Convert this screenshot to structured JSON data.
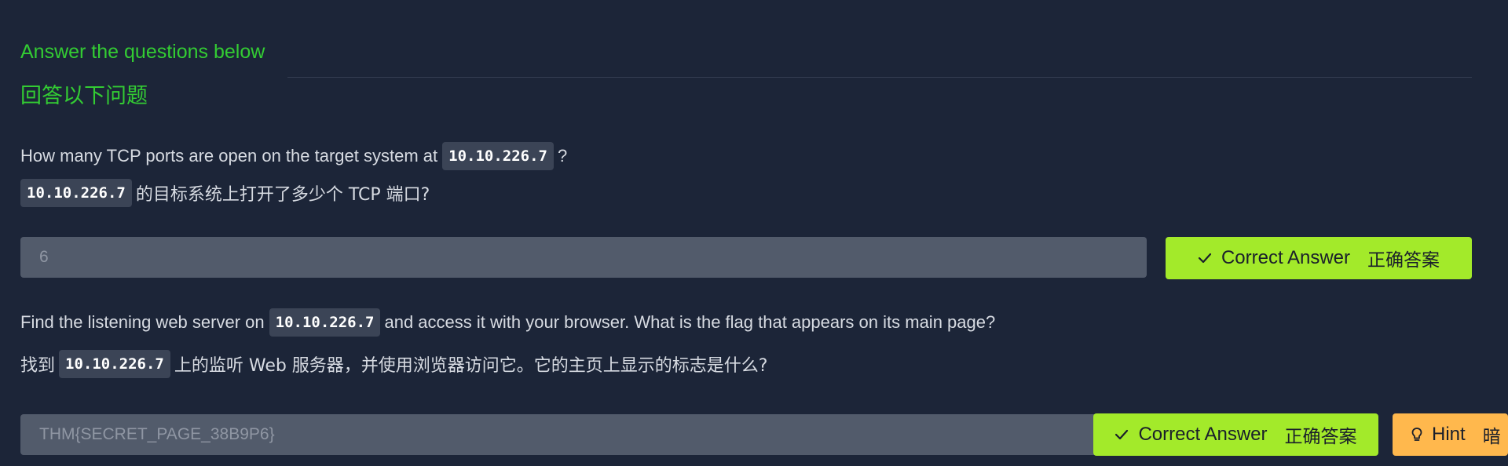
{
  "header": {
    "title_en": "Answer the questions below",
    "title_zh": "回答以下问题"
  },
  "questions": [
    {
      "en_before": "How many TCP ports are open on the target system at",
      "en_code": "10.10.226.7",
      "en_after": "?",
      "zh_code": "10.10.226.7",
      "zh_after": "的目标系统上打开了多少个 TCP 端口?",
      "answer_value": "6",
      "correct_label": "Correct Answer",
      "correct_label_zh": "正确答案"
    },
    {
      "en_before": "Find the listening web server on",
      "en_code": "10.10.226.7",
      "en_after": "and access it with your browser. What is the flag that appears on its main page?",
      "zh_before": "找到",
      "zh_code": "10.10.226.7",
      "zh_after": "上的监听 Web 服务器，并使用浏览器访问它。它的主页上显示的标志是什么?",
      "answer_value": "THM{SECRET_PAGE_38B9P6}",
      "correct_label": "Correct Answer",
      "correct_label_zh": "正确答案",
      "hint_label": "Hint",
      "hint_label_zh": "暗"
    }
  ],
  "icons": {
    "check": "check-icon",
    "hint": "lightbulb-icon"
  },
  "colors": {
    "background": "#1c2538",
    "header": "#33cc33",
    "correct_button": "#a3ea2a",
    "hint_button": "#ffb84d",
    "answer_box": "#525b6b"
  }
}
